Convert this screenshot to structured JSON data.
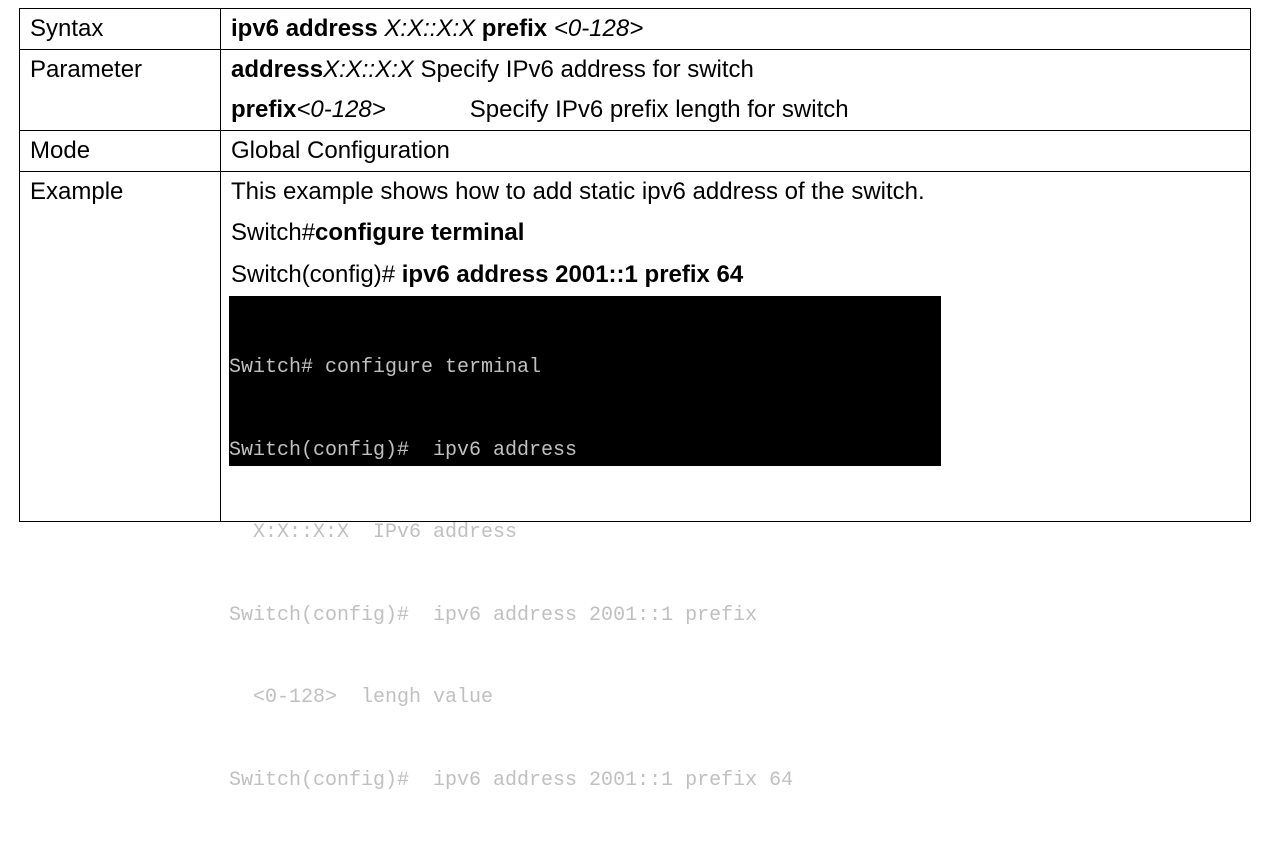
{
  "rows": {
    "syntax": {
      "label": "Syntax",
      "cmd1": "ipv6 address",
      "arg1": "X:X::X:X",
      "cmd2": "prefix",
      "arg2": "<0-128>"
    },
    "parameter": {
      "label": "Parameter",
      "line1_cmd": "address",
      "line1_arg": "X:X::X:X",
      "line1_desc": "Specify IPv6 address for switch",
      "line2_cmd": "prefix",
      "line2_arg": "<0-128>",
      "line2_desc": "Specify IPv6 prefix length for switch"
    },
    "mode": {
      "label": "Mode",
      "value": "Global Configuration"
    },
    "example": {
      "label": "Example",
      "intro": "This example shows how to add static ipv6 address of the switch.",
      "step1_prompt": "Switch#",
      "step1_cmd": "configure terminal",
      "step2_prompt": "Switch(config)# ",
      "step2_cmd": "ipv6 address 2001::1 prefix 64",
      "terminal_lines": [
        "Switch# configure terminal",
        "Switch(config)#  ipv6 address",
        "  X:X::X:X  IPv6 address",
        "Switch(config)#  ipv6 address 2001::1 prefix",
        "  <0-128>  lengh value",
        "Switch(config)#  ipv6 address 2001::1 prefix 64"
      ]
    }
  }
}
